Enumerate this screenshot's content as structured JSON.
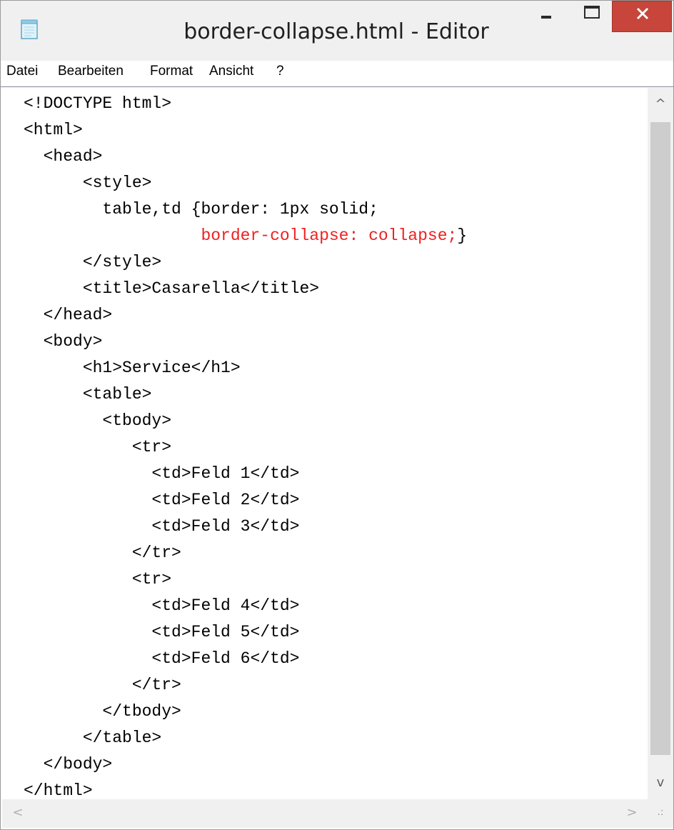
{
  "window": {
    "title": "border-collapse.html - Editor",
    "icon": "notepad-icon",
    "controls": {
      "minimize_icon": "minimize-icon",
      "maximize_icon": "maximize-icon",
      "close_icon": "close-icon"
    },
    "accent_close_color": "#c7453a"
  },
  "menubar": {
    "items": [
      {
        "label": "Datei"
      },
      {
        "label": "Bearbeiten"
      },
      {
        "label": "Format"
      },
      {
        "label": "Ansicht"
      },
      {
        "label": "?"
      }
    ]
  },
  "editor": {
    "highlight_color": "#f02020",
    "lines": [
      {
        "text": "<!DOCTYPE html>",
        "highlight": false
      },
      {
        "text": "<html>",
        "highlight": false
      },
      {
        "text": "  <head>",
        "highlight": false
      },
      {
        "text": "      <style>",
        "highlight": false
      },
      {
        "text": "        table,td {border: 1px solid;",
        "highlight": false
      },
      {
        "text": "                  border-collapse: collapse;}",
        "highlight": true,
        "prefix": "                  ",
        "highlight_text": "border-collapse: collapse;",
        "suffix": "}"
      },
      {
        "text": "      </style>",
        "highlight": false
      },
      {
        "text": "      <title>Casarella</title>",
        "highlight": false
      },
      {
        "text": "  </head>",
        "highlight": false
      },
      {
        "text": "  <body>",
        "highlight": false
      },
      {
        "text": "      <h1>Service</h1>",
        "highlight": false
      },
      {
        "text": "      <table>",
        "highlight": false
      },
      {
        "text": "        <tbody>",
        "highlight": false
      },
      {
        "text": "           <tr>",
        "highlight": false
      },
      {
        "text": "             <td>Feld 1</td>",
        "highlight": false
      },
      {
        "text": "             <td>Feld 2</td>",
        "highlight": false
      },
      {
        "text": "             <td>Feld 3</td>",
        "highlight": false
      },
      {
        "text": "           </tr>",
        "highlight": false
      },
      {
        "text": "           <tr>",
        "highlight": false
      },
      {
        "text": "             <td>Feld 4</td>",
        "highlight": false
      },
      {
        "text": "             <td>Feld 5</td>",
        "highlight": false
      },
      {
        "text": "             <td>Feld 6</td>",
        "highlight": false
      },
      {
        "text": "           </tr>",
        "highlight": false
      },
      {
        "text": "        </tbody>",
        "highlight": false
      },
      {
        "text": "      </table>",
        "highlight": false
      },
      {
        "text": "  </body>",
        "highlight": false
      },
      {
        "text": "</html>",
        "highlight": false
      }
    ]
  },
  "scrollbars": {
    "up_glyph": "^",
    "down_glyph": "v",
    "left_glyph": "<",
    "right_glyph": ">",
    "grip_glyph": ".:"
  }
}
